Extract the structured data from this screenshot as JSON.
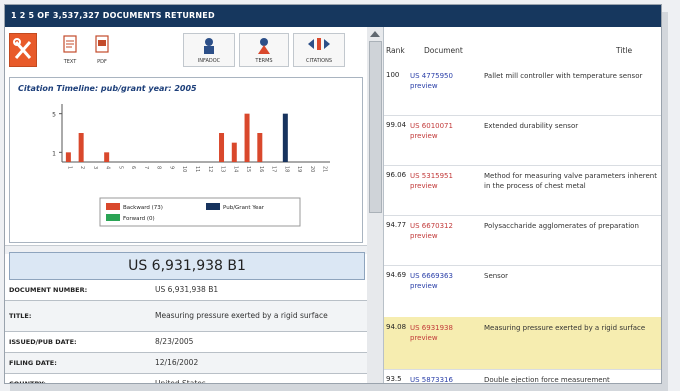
{
  "header": {
    "title": "1 2 5 OF 3,537,327 DOCUMENTS RETURNED"
  },
  "toolbar": {
    "buttons": [
      {
        "label": "TEXT",
        "icon": "text-doc-icon"
      },
      {
        "label": "PDF",
        "icon": "pdf-doc-icon"
      },
      {
        "label": "INFADOC",
        "icon": "infadoc-icon"
      },
      {
        "label": "TERMS",
        "icon": "terms-icon"
      },
      {
        "label": "CITATIONS",
        "icon": "citations-icon"
      }
    ]
  },
  "chart_data": {
    "type": "bar",
    "title": "Citation Timeline: pub/grant year: 2005",
    "categories": [
      "1",
      "2",
      "3",
      "4",
      "5",
      "6",
      "7",
      "8",
      "9",
      "10",
      "11",
      "12",
      "13",
      "14",
      "15",
      "16",
      "17",
      "18",
      "19",
      "20",
      "21"
    ],
    "series": [
      {
        "name": "Backward (73)",
        "values": [
          1,
          3,
          0,
          1,
          0,
          0,
          0,
          0,
          0,
          0,
          0,
          0,
          3,
          2,
          5,
          3,
          0,
          0,
          0,
          0,
          0
        ]
      },
      {
        "name": "Pub/Grant Year",
        "values": [
          0,
          0,
          0,
          0,
          0,
          0,
          0,
          0,
          0,
          0,
          0,
          0,
          0,
          0,
          0,
          0,
          0,
          5,
          0,
          0,
          0
        ]
      },
      {
        "name": "Forward (0)",
        "values": [
          0,
          0,
          0,
          0,
          0,
          0,
          0,
          0,
          0,
          0,
          0,
          0,
          0,
          0,
          0,
          0,
          0,
          0,
          0,
          0,
          0
        ]
      }
    ],
    "ylim": [
      0,
      6
    ],
    "yticks": [
      "5",
      "1"
    ],
    "colors": {
      "backward": "#d9482c",
      "pubgrant": "#17335e",
      "forward": "#2aa455"
    },
    "legend": "bottom-center",
    "grid": false
  },
  "patent": {
    "heading": "US 6,931,938 B1",
    "fields": [
      {
        "key": "DOCUMENT NUMBER:",
        "value": "US 6,931,938 B1"
      },
      {
        "key": "TITLE:",
        "value": "Measuring pressure exerted by a rigid surface"
      },
      {
        "key": "ISSUED/PUB DATE:",
        "value": "8/23/2005"
      },
      {
        "key": "FILING DATE:",
        "value": "12/16/2002"
      },
      {
        "key": "COUNTRY:",
        "value": "United States"
      }
    ]
  },
  "results": {
    "headers": {
      "rank": "Rank",
      "document": "Document",
      "title": "Title"
    },
    "rows": [
      {
        "rank": "100",
        "doc": "US 4775950",
        "preview": "preview",
        "title": "Pallet mill controller with temperature sensor",
        "highlight": false
      },
      {
        "rank": "99.04",
        "doc": "US 6010071",
        "preview": "preview",
        "title": "Extended durability sensor",
        "highlight": false
      },
      {
        "rank": "96.06",
        "doc": "US 5315951",
        "preview": "preview",
        "title": "Method for measuring valve parameters inherent in the process of chest metal",
        "highlight": false
      },
      {
        "rank": "94.77",
        "doc": "US 6670312",
        "preview": "preview",
        "title": "Polysaccharide agglomerates of preparation",
        "highlight": false
      },
      {
        "rank": "94.69",
        "doc": "US 6669363",
        "preview": "preview",
        "title": "Sensor",
        "highlight": false
      },
      {
        "rank": "94.08",
        "doc": "US 6931938",
        "preview": "preview",
        "title": "Measuring pressure exerted by a rigid surface",
        "highlight": true
      },
      {
        "rank": "93.5",
        "doc": "US 5873316",
        "preview": "preview",
        "title": "Double ejection force measurement",
        "highlight": false
      }
    ]
  }
}
